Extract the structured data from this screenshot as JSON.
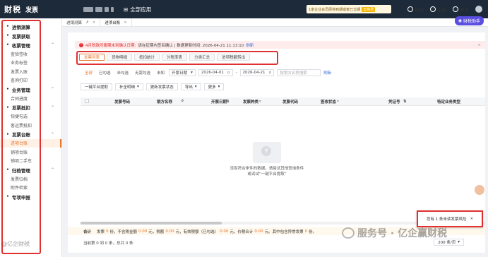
{
  "app": {
    "logo": "财税",
    "title": "发票",
    "all_apps": "全部应用"
  },
  "topnotice": {
    "text": "1家企业会员即将到期或者已过期",
    "badge": "去续费"
  },
  "topright": {
    "help": "帮助",
    "enterprise": "企业",
    "messages": "消息"
  },
  "sidebar": {
    "groups": [
      {
        "label": "进销测算",
        "items": []
      },
      {
        "label": "发票获取",
        "items": []
      },
      {
        "label": "收票管理",
        "items": [
          "查验签收",
          "业务标签",
          "发票入账",
          "查询打印"
        ]
      },
      {
        "label": "业务管理",
        "items": [
          "合同进度"
        ]
      },
      {
        "label": "发票抵扣",
        "items": [
          "快捷勾选",
          "客运票抵扣"
        ]
      },
      {
        "label": "发票台账",
        "items": [
          "进项台账",
          "销项台账",
          "销项二手车"
        ]
      },
      {
        "label": "归档管理",
        "items": [
          "发票归档",
          "附件检索"
        ]
      },
      {
        "label": "专项申报",
        "items": []
      }
    ],
    "active_item": "进项台账"
  },
  "tabs": [
    {
      "label": "进销测算"
    },
    {
      "label": "进项台账"
    }
  ],
  "assistant": {
    "label": "财税助手"
  },
  "alert": {
    "prefix": "4月税款所属期未到确认日期:",
    "text": "请在征期内签名确认 | 数据更新时间: 2026-04-21 11:13:10",
    "link": "刷新"
  },
  "subtabs": [
    "发票列表",
    "货物明细",
    "抵扣统计",
    "分税率表",
    "分类汇总",
    "进项税额转出"
  ],
  "filters": {
    "chips": [
      "全部",
      "已勾选",
      "未勾选",
      "无需勾选",
      "未知"
    ],
    "date_type": "开票日期",
    "date_from": "2026-04-01",
    "date_sep": "-",
    "date_to": "2026-04-21",
    "search_placeholder": "按销方名称搜索",
    "refresh": "刷新"
  },
  "actions": [
    "一键平台提取",
    "补全明细",
    "更新发票状态",
    "导出",
    "更多"
  ],
  "table": {
    "columns": [
      "发票号码",
      "销方名称",
      "开票日期",
      "发票种类",
      "发票代码",
      "签收状态",
      "凭证号",
      "特定业务类型"
    ]
  },
  "empty": {
    "line1": "没有符合条件的数据。请尝试其他查询条件",
    "line2": "或试试“一键平台提取”"
  },
  "total": {
    "label": "合计",
    "text1": "发票",
    "count": "0",
    "text2": "份，不含税金额",
    "amount": "0.00",
    "text3": "元，税额",
    "tax": "0.00",
    "text4": "元，有效税额（已勾选）",
    "valid_tax": "0.00",
    "text5": "元，价税合计",
    "gross": "0.00",
    "text6": "元。其中包含异常发票",
    "abnormal": "0",
    "text7": "份。"
  },
  "pager": {
    "text": "当前第 0 到 0 条，总共 0 条",
    "page_size": "200 条/页"
  },
  "risk": {
    "text": "您有 1 条未读发票风险"
  },
  "watermark": {
    "text": "服务号 · 亿企赢财税"
  },
  "bottomleft": {
    "text": "@亿企财税"
  }
}
